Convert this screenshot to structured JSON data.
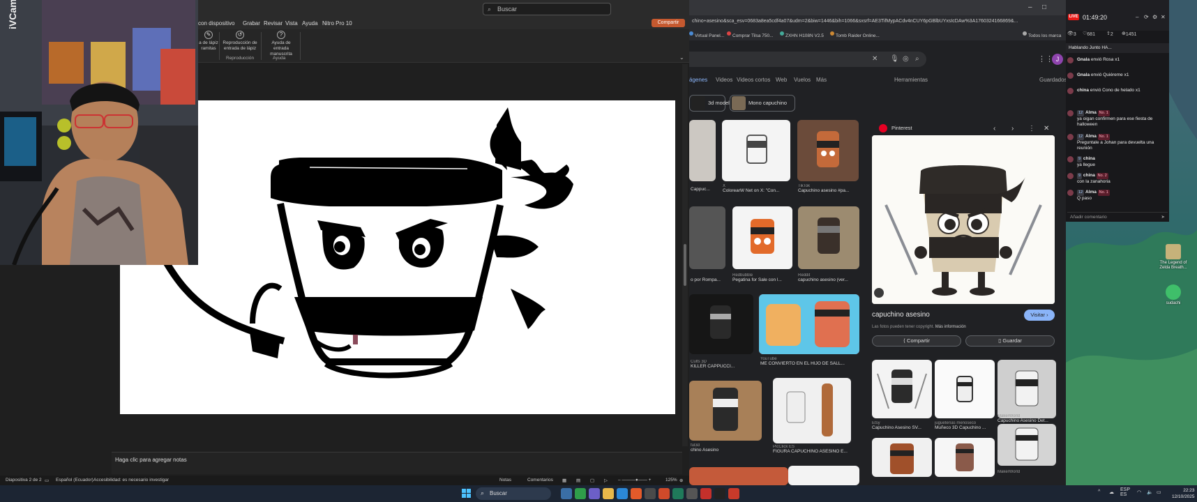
{
  "powerpoint": {
    "search_placeholder": "Buscar",
    "menu": [
      "con dispositivo",
      "Grabar",
      "Revisar",
      "Vista",
      "Ayuda",
      "Nitro Pro 10"
    ],
    "share_label": "Compartir",
    "ribbon": {
      "item1": "a de lápiz\nramitas",
      "item2": "Reproducción de\nentrada de lápiz",
      "item3": "Ayuda de entrada\nmanuscrita",
      "group1": "Reproducción",
      "group2": "Ayuda"
    },
    "notes_placeholder": "Haga clic para agregar notas",
    "status": {
      "slide": "Diapositiva 2 de 2",
      "language": "Español (Ecuador)",
      "accessibility": "Accesibilidad: es necesario investigar",
      "notes": "Notas",
      "comments": "Comentarios",
      "zoom": "125%"
    }
  },
  "webcam": {
    "tag": "iVCam"
  },
  "browser": {
    "url": "chino+asesino&sca_esv=0683a8ea5cdf4a07&udm=2&biw=1446&bih=1066&sxsrf=AE3TifMypACdv4nCUY6pGBlbUYxsIcDAw%3A1760324166869&...",
    "bookmarks": [
      "Virtual Panel...",
      "Comprar Tilsa 750...",
      "ZXHN H108N V2.5",
      "Tomb Raider Online...",
      "Todos los marca"
    ],
    "nav": [
      "ágenes",
      "Videos",
      "Videos cortos",
      "Web",
      "Vuelos",
      "Más",
      "Herramientas",
      "Guardados"
    ],
    "chips": [
      "3d model",
      "Mono capuchino"
    ],
    "results": [
      {
        "title": "Cappuc...",
        "source": ""
      },
      {
        "title": "ColorearW Net on X: \"Con...",
        "source": "X"
      },
      {
        "title": "Capuchino asesino #pa...",
        "source": "TikTok"
      },
      {
        "title": "o por Rompa...",
        "source": ""
      },
      {
        "title": "Pegatina for Sale con l...",
        "source": "Redbubble"
      },
      {
        "title": "capuchino asesino (ver...",
        "source": "Reddit"
      },
      {
        "title": "KILLER CAPPUCCI...",
        "source": "Cults 3D"
      },
      {
        "title": "ME CONVIERTO EN EL HIJO DE SALL...",
        "source": "YouTube"
      },
      {
        "title": "chino Asesino",
        "source": "ful3d"
      },
      {
        "title": "FIGURA CAPUCHINO ASESINO E...",
        "source": "PicClick ES"
      },
      {
        "title": "Capuchino Asesino SV...",
        "source": "Etsy"
      },
      {
        "title": "Muñeco 3D Capuchino ...",
        "source": "jugueterías menoseco"
      },
      {
        "title": "Capuchino Asesino Det...",
        "source": "MakerWorld"
      },
      {
        "title": "",
        "source": "MakerWorld"
      }
    ],
    "preview": {
      "source": "Pinterest",
      "title": "capuchino asesino",
      "visit_label": "Visitar",
      "copyright": "Las fotos pueden tener copyright.",
      "more_info": "Más información",
      "share_label": "Compartir",
      "save_label": "Guardar"
    }
  },
  "chat": {
    "live_label": "LIVE",
    "time": "01:49:20",
    "stats": [
      "3",
      "681",
      "2",
      "1451"
    ],
    "pinned": "Hablando Junto HA...",
    "messages": [
      {
        "name": "Gnala",
        "text": "envió Rosa",
        "count": "x1",
        "badge": "",
        "rank": ""
      },
      {
        "name": "Gnala",
        "text": "envió Quiéreme",
        "count": "x1",
        "badge": "",
        "rank": ""
      },
      {
        "name": "china",
        "text": "envió Cono de helado",
        "count": "x1",
        "badge": "",
        "rank": ""
      },
      {
        "name": "Alma",
        "text": "ya oigan confirmen para ese fiesta de halloween",
        "count": "",
        "badge": "12",
        "rank": "No. 1"
      },
      {
        "name": "Alma",
        "text": "Preguntale a Johan para devuelta una reunión",
        "count": "",
        "badge": "12",
        "rank": "No. 1"
      },
      {
        "name": "china",
        "text": "ya llegue",
        "count": "",
        "badge": "9",
        "rank": ""
      },
      {
        "name": "china",
        "text": "con la zanahoria",
        "count": "",
        "badge": "9",
        "rank": "No. 2"
      },
      {
        "name": "Alma",
        "text": "Q paso",
        "count": "",
        "badge": "12",
        "rank": "No. 1"
      }
    ],
    "input_placeholder": "Añadir comentario"
  },
  "desktop": {
    "icons": [
      "The Legend of Zelda Breath...",
      "sudachi"
    ]
  },
  "taskbar": {
    "search_label": "Buscar",
    "lang": "ESP\nES",
    "time": "22:23",
    "date": "12/10/2025"
  },
  "colors": {
    "ppt_bg": "#1f1f1f",
    "accent_share": "#c5592f",
    "browser_bg": "#202124",
    "link_blue": "#8ab4f8",
    "live_red": "#e91916"
  }
}
